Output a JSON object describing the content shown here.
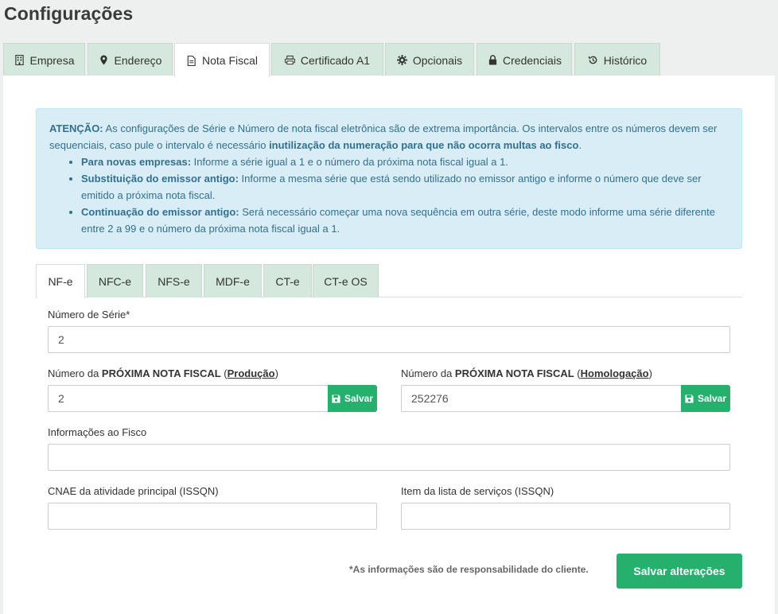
{
  "page": {
    "title": "Configurações"
  },
  "top_tabs": [
    {
      "label": "Empresa",
      "icon": "building-icon"
    },
    {
      "label": "Endereço",
      "icon": "map-marker-icon"
    },
    {
      "label": "Nota Fiscal",
      "icon": "file-icon",
      "active": true
    },
    {
      "label": "Certificado A1",
      "icon": "printer-icon"
    },
    {
      "label": "Opcionais",
      "icon": "gear-icon"
    },
    {
      "label": "Credenciais",
      "icon": "lock-icon"
    },
    {
      "label": "Histórico",
      "icon": "history-icon"
    }
  ],
  "alert": {
    "lead_bold": "ATENÇÃO:",
    "lead_text": " As configurações de Série e Número de nota fiscal eletrônica são de extrema importância. Os intervalos entre os números devem ser sequenciais, caso pule o intervalo é necessário ",
    "lead_bold2": "inutilização da numeração para que não ocorra multas ao fisco",
    "lead_end": ".",
    "items": [
      {
        "bold": "Para novas empresas:",
        "text": " Informe a série igual a 1 e o número da próxima nota fiscal igual a 1."
      },
      {
        "bold": "Substituição do emissor antigo:",
        "text": " Informe a mesma série que está sendo utilizado no emissor antigo e informe o número que deve ser emitido a próxima nota fiscal."
      },
      {
        "bold": "Continuação do emissor antigo:",
        "text": " Será necessário começar uma nova sequência em outra série, deste modo informe uma série diferente entre 2 a 99 e o número da próxima nota fiscal igual a 1."
      }
    ]
  },
  "sub_tabs": [
    "NF-e",
    "NFC-e",
    "NFS-e",
    "MDF-e",
    "CT-e",
    "CT-e OS"
  ],
  "form": {
    "serie_label": "Número de Série*",
    "serie_value": "2",
    "prod_label_a": "Número da ",
    "prod_label_b": "PRÓXIMA NOTA FISCAL",
    "prod_label_c": " (",
    "prod_label_d": "Produção",
    "prod_label_e": ")",
    "prod_value": "2",
    "homo_label_a": "Número da ",
    "homo_label_b": "PRÓXIMA NOTA FISCAL",
    "homo_label_c": " (",
    "homo_label_d": "Homologação",
    "homo_label_e": ")",
    "homo_value": "252276",
    "save_label": "Salvar",
    "fisco_label": "Informações ao Fisco",
    "fisco_value": "",
    "cnae_label": "CNAE da atividade principal (ISSQN)",
    "cnae_value": "",
    "item_label": "Item da lista de serviços (ISSQN)",
    "item_value": ""
  },
  "footer": {
    "note": "*As informações são de responsabilidade do cliente.",
    "submit_label": "Salvar alterações"
  },
  "colors": {
    "accent": "#26b06e",
    "tab_bg": "#d4e8dd",
    "alert_bg": "#d9edf7",
    "alert_text": "#31708f"
  }
}
